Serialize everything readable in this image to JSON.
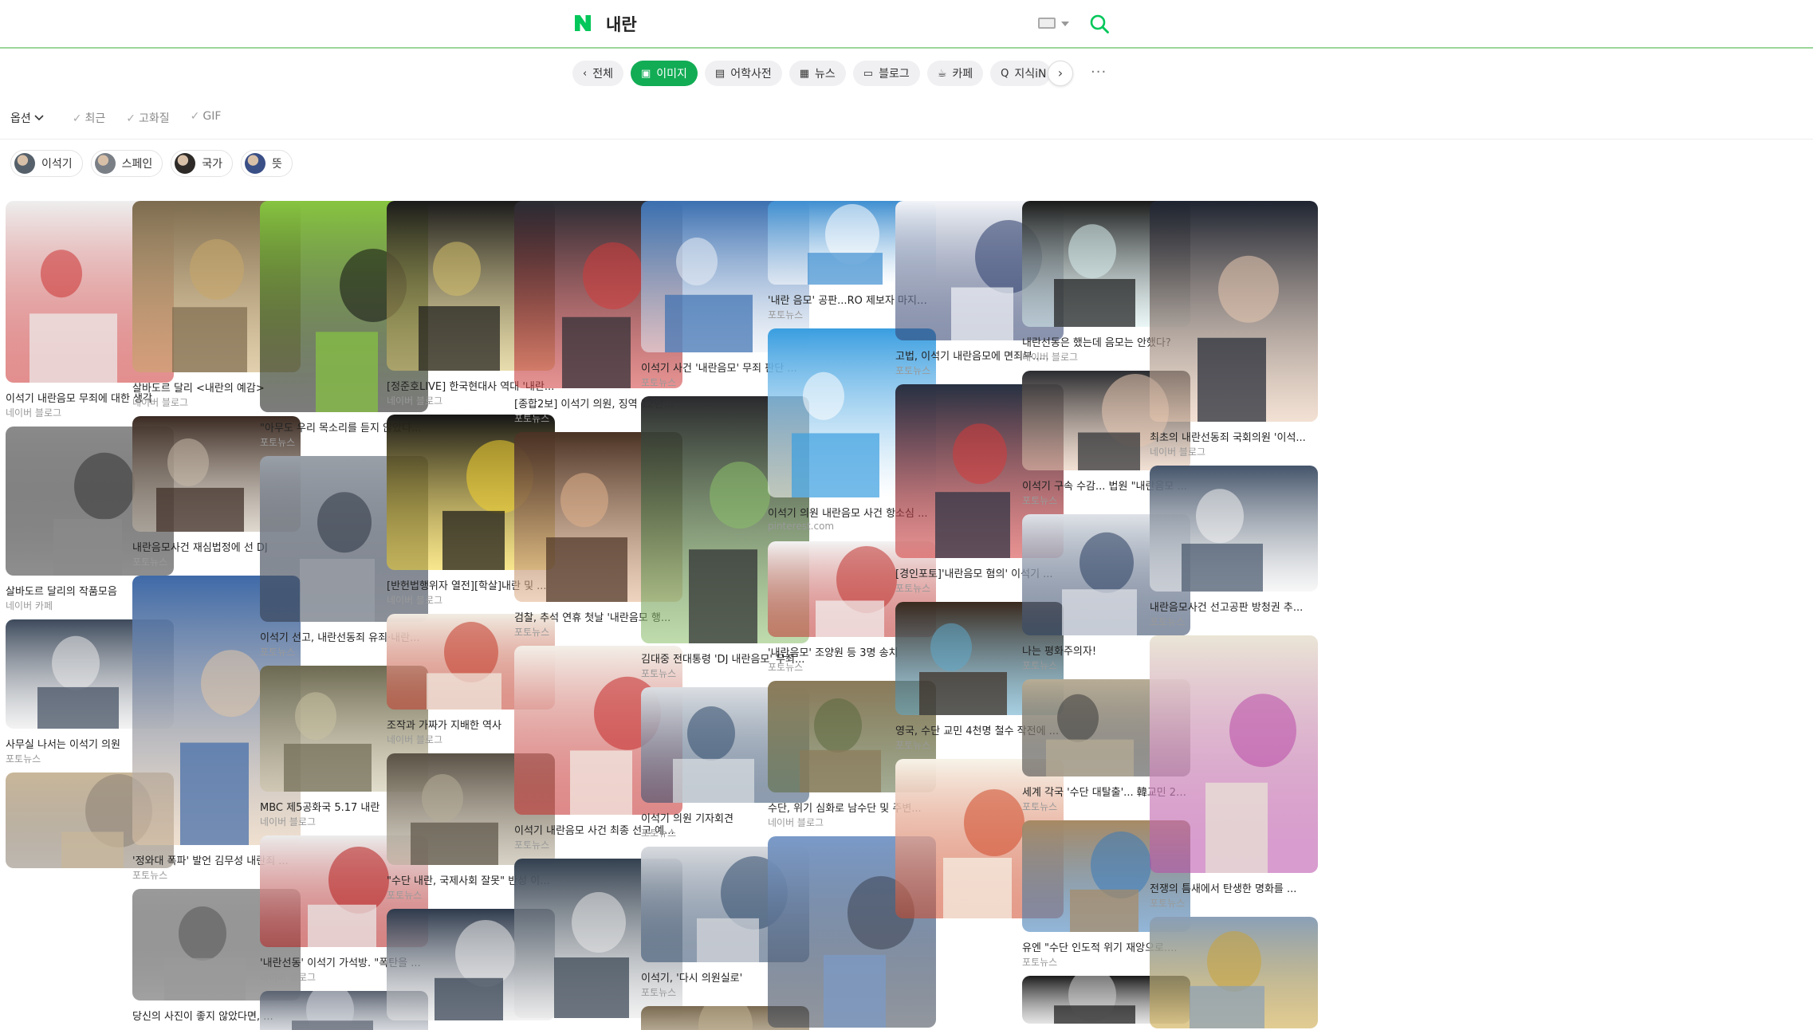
{
  "header": {
    "query": "내란",
    "logo_icon": "naver-n-logo",
    "search_icon": "search-icon",
    "keyboard_icon": "keyboard-icon"
  },
  "tabs": [
    {
      "label": "전체",
      "icon": "chevron-left-icon"
    },
    {
      "label": "이미지",
      "icon": "image-icon",
      "active": true
    },
    {
      "label": "어학사전",
      "icon": "dictionary-icon"
    },
    {
      "label": "뉴스",
      "icon": "news-icon"
    },
    {
      "label": "블로그",
      "icon": "blog-icon"
    },
    {
      "label": "카페",
      "icon": "cafe-icon"
    },
    {
      "label": "지식iN",
      "icon": "question-icon"
    }
  ],
  "options": {
    "menu_label": "옵션",
    "filters": [
      "최근",
      "고화질",
      "GIF"
    ]
  },
  "chips": [
    {
      "label": "이석기",
      "color": "#55606a"
    },
    {
      "label": "스페인",
      "color": "#7a7f86"
    },
    {
      "label": "국가",
      "color": "#2d2a28"
    },
    {
      "label": "뜻",
      "color": "#3a4f86"
    }
  ],
  "columns": [
    [
      {
        "caption": "이석기 내란음모 무죄에 대한 생각",
        "source": "네이버 블로그",
        "color": "#eeeeee",
        "accent": "#cc3333",
        "h": 228
      },
      {
        "caption": "살바도르 달리의 작품모음",
        "source": "네이버 카페",
        "color": "#8a8a8a",
        "accent": "#333333",
        "h": 187
      },
      {
        "caption": "사무실 나서는 이석기 의원",
        "source": "포토뉴스",
        "color": "#3d4a5c",
        "accent": "#e8e8e8",
        "h": 137
      },
      {
        "caption": "",
        "source": "",
        "color": "#c9b79a",
        "accent": "#8a7f72",
        "h": 120
      }
    ],
    [
      {
        "caption": "살바도르 달리 <내란의 예감>",
        "source": "네이버 블로그",
        "color": "#7d6b4f",
        "accent": "#c9a86a",
        "h": 215
      },
      {
        "caption": "내란음모사건 재심법정에 선 DJ",
        "source": "포토뉴스",
        "color": "#3a2a22",
        "accent": "#c4b8a8",
        "h": 145
      },
      {
        "caption": "'정와대 폭파' 발언 김무성 내란죄 ...",
        "source": "포토뉴스",
        "color": "#3f6aa8",
        "accent": "#e2c6a8",
        "h": 338
      },
      {
        "caption": "당신의 사진이 좋지 않았다면, ...",
        "source": "",
        "color": "#9a9a9a",
        "accent": "#555555",
        "h": 140
      }
    ],
    [
      {
        "caption": "\"아무도 우리 목소리를 듣지 않았다...",
        "source": "포토뉴스",
        "color": "#87c540",
        "accent": "#111111",
        "h": 265
      },
      {
        "caption": "이석기 선고, 내란선동죄 유죄·내란...",
        "source": "포토뉴스",
        "color": "#9aa0a8",
        "accent": "#2b3444",
        "h": 208
      },
      {
        "caption": "MBC 제5공화국 5.17 내란",
        "source": "네이버 블로그",
        "color": "#6d6a52",
        "accent": "#c9c1a2",
        "h": 158
      },
      {
        "caption": "'내란선동' 이석기 가석방. \"폭탄을 ...",
        "source": "네이버 블로그",
        "color": "#ececec",
        "accent": "#b61e1e",
        "h": 140
      },
      {
        "caption": "",
        "source": "",
        "color": "#5a6270",
        "accent": "#d0d4da",
        "h": 60
      }
    ],
    [
      {
        "caption": "[정준호LIVE] 한국현대사 역대 '내란...",
        "source": "네이버 블로그",
        "color": "#1a1a1a",
        "accent": "#d4c06a",
        "h": 213
      },
      {
        "caption": "[반헌법행위자 열전][학살]내란 및 ...",
        "source": "네이버 블로그",
        "color": "#151515",
        "accent": "#f2d230",
        "h": 195
      },
      {
        "caption": "조작과 가짜가 지배한 역사",
        "source": "네이버 블로그",
        "color": "#f1ece2",
        "accent": "#c23b2a",
        "h": 120
      },
      {
        "caption": "\"수단 내란, 국제사회 잘못\" 반성 이...",
        "source": "포토뉴스",
        "color": "#5a5246",
        "accent": "#b7ad98",
        "h": 140
      },
      {
        "caption": "",
        "source": "",
        "color": "#2e3a4c",
        "accent": "#e8e8e8",
        "h": 140
      }
    ],
    [
      {
        "caption": "[종합2보] 이석기 의원, 징역 12년에...",
        "source": "포토뉴스",
        "color": "#2a2c33",
        "accent": "#d23a3a",
        "h": 235
      },
      {
        "caption": "검찰, 추석 연휴 첫날 '내란음모 행...",
        "source": "포토뉴스",
        "color": "#4a3224",
        "accent": "#e0b08a",
        "h": 213
      },
      {
        "caption": "이석기 내란음모 사건 최종 선고 예...",
        "source": "포토뉴스",
        "color": "#f3efe8",
        "accent": "#c42a2a",
        "h": 212
      },
      {
        "caption": "",
        "source": "",
        "color": "#33404f",
        "accent": "#e6e6e6",
        "h": 200
      }
    ],
    [
      {
        "caption": "이석기 사건 '내란음모' 무죄 판단 ...",
        "source": "포토뉴스",
        "color": "#3b6fb0",
        "accent": "#e9eef6",
        "h": 190
      },
      {
        "caption": "김대중 전대통령 'DJ 내란음모' 무죄...",
        "source": "포토뉴스",
        "color": "#2a2a2e",
        "accent": "#8bbf6a",
        "h": 310
      },
      {
        "caption": "이석기 의원 기자회견",
        "source": "포토뉴스",
        "color": "#dcdfe3",
        "accent": "#2f4a6b",
        "h": 145
      },
      {
        "caption": "이석기, '다시 의원실로'",
        "source": "포토뉴스",
        "color": "#d8dade",
        "accent": "#2f4a6b",
        "h": 145
      },
      {
        "caption": "",
        "source": "",
        "color": "#7a6a52",
        "accent": "#c0b090",
        "h": 60
      }
    ],
    [
      {
        "caption": "'내란 음모' 공판...RO 제보자 마지막...",
        "source": "포토뉴스",
        "color": "#3e8ed0",
        "accent": "#ffffff",
        "h": 105
      },
      {
        "caption": "이석기 의원 내란음모 사건 항소심 ...",
        "source": "pinterest.com",
        "color": "#3a9ee0",
        "accent": "#ffffff",
        "h": 212
      },
      {
        "caption": "'내란음모' 조양원 등 3명 송치",
        "source": "포토뉴스",
        "color": "#f3f3f3",
        "accent": "#c0332f",
        "h": 120
      },
      {
        "caption": "수단, 위기 심화로 남수단 및 주변...",
        "source": "네이버 블로그",
        "color": "#8a7a5a",
        "accent": "#5b6a3e",
        "h": 140
      },
      {
        "caption": "",
        "source": "",
        "color": "#7a9ac8",
        "accent": "#3a4250",
        "h": 240
      }
    ],
    [
      {
        "caption": "고법, 이석기 내란음모에 면죄부.....",
        "source": "포토뉴스",
        "color": "#f2f4f8",
        "accent": "#2a3a6a",
        "h": 175
      },
      {
        "caption": "[경인포토]'내란음모 혐의' 이석기 ...",
        "source": "포토뉴스",
        "color": "#263142",
        "accent": "#d43a3a",
        "h": 218
      },
      {
        "caption": "영국, 수단 교민 4천명 철수 작전에 ...",
        "source": "포토뉴스",
        "color": "#3a2a1e",
        "accent": "#5fa8c8",
        "h": 142
      },
      {
        "caption": "",
        "source": "",
        "color": "#f7f3e8",
        "accent": "#d04a2a",
        "h": 200
      }
    ],
    [
      {
        "caption": "내란선동은 했는데 음모는 안했다?",
        "source": "네이버 블로그",
        "color": "#1a1a1a",
        "accent": "#d9efee",
        "h": 158
      },
      {
        "caption": "이석기 구속 수감... 법원 \"내란음모 ...",
        "source": "포토뉴스",
        "color": "#2a2c30",
        "accent": "#e6c6b0",
        "h": 125
      },
      {
        "caption": "나는 평화주의자!",
        "source": "포토뉴스",
        "color": "#dfe3e8",
        "accent": "#2a3e60",
        "h": 152
      },
      {
        "caption": "세계 각국 '수단 대탈출'... 韓교민 28...",
        "source": "포토뉴스",
        "color": "#b8ad96",
        "accent": "#3c3c3c",
        "h": 122
      },
      {
        "caption": "유엔 \"수단 인도적 위기 재앙으로....",
        "source": "포토뉴스",
        "color": "#a88a64",
        "accent": "#3a7ab8",
        "h": 140
      },
      {
        "caption": "",
        "source": "",
        "color": "#1a1a1a",
        "accent": "#cccccc",
        "h": 60
      }
    ],
    [
      {
        "caption": "최초의 내란선동죄 국회의원 '이석...",
        "source": "네이버 블로그",
        "color": "#1e2430",
        "accent": "#e8c8b0",
        "h": 277
      },
      {
        "caption": "내란음모사건 선고공판 방청권 추...",
        "source": "포토뉴스",
        "color": "#44546a",
        "accent": "#f1f1f1",
        "h": 158
      },
      {
        "caption": "전쟁의 틈새에서 탄생한 명화를 ...",
        "source": "포토뉴스",
        "color": "#eae5d6",
        "accent": "#b94aa8",
        "h": 298
      },
      {
        "caption": "",
        "source": "",
        "color": "#8aa0b8",
        "accent": "#c9a23a",
        "h": 140
      }
    ]
  ]
}
